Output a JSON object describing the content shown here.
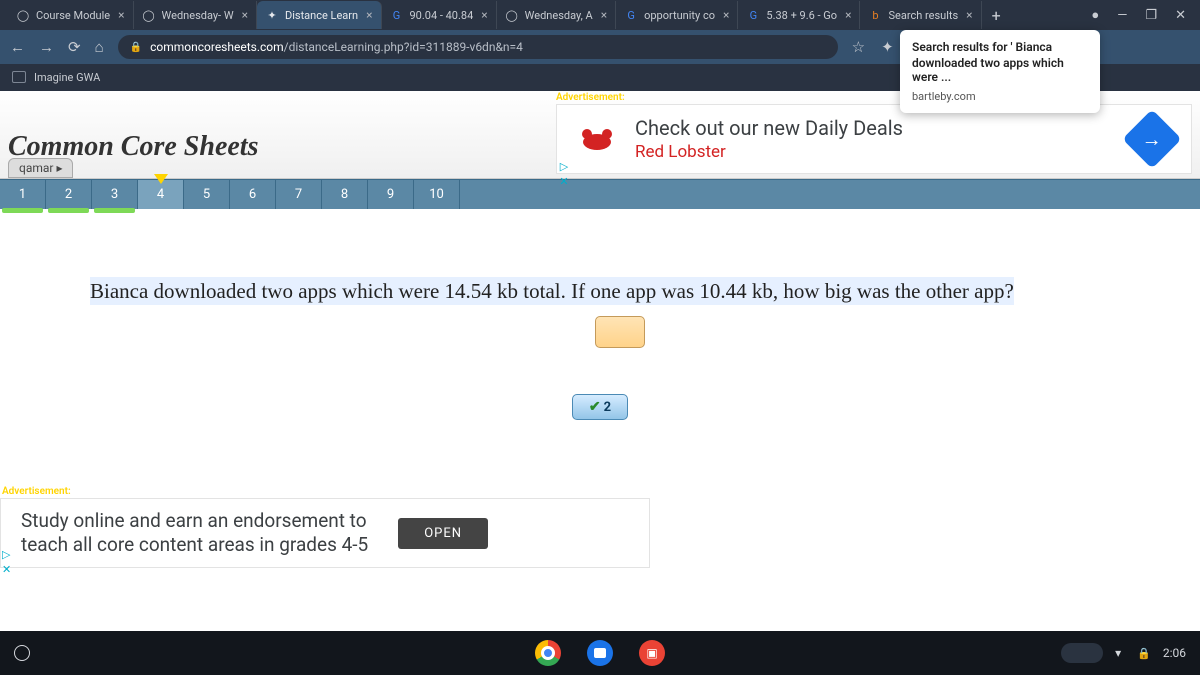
{
  "browser": {
    "tabs": [
      {
        "title": "Course Module"
      },
      {
        "title": "Wednesday- W"
      },
      {
        "title": "Distance Learn",
        "active": true
      },
      {
        "title": "90.04 - 40.84"
      },
      {
        "title": "Wednesday, A"
      },
      {
        "title": "opportunity co"
      },
      {
        "title": "5.38 + 9.6 - Go"
      },
      {
        "title": "Search results"
      }
    ],
    "url_host": "commoncoresheets.com",
    "url_path": "/distanceLearning.php?id=311889-v6dn&n=4",
    "bookmark": "Imagine GWA"
  },
  "search_popup": {
    "line1": "Search results for ' Bianca",
    "line2": "downloaded two apps which were ...",
    "site": "bartleby.com"
  },
  "site": {
    "title": "Common Core Sheets",
    "user": "qamar ▸"
  },
  "ad_top": {
    "label": "Advertisement:",
    "headline": "Check out our new Daily Deals",
    "sub": "Red Lobster"
  },
  "questions": [
    "1",
    "2",
    "3",
    "4",
    "5",
    "6",
    "7",
    "8",
    "9",
    "10"
  ],
  "current_q": 4,
  "done_q": [
    1,
    2,
    3
  ],
  "problem": "Bianca downloaded two apps which were 14.54 kb total. If one app was 10.44 kb, how big was the other app?",
  "check_label": "2",
  "ad_bottom": {
    "label": "Advertisement:",
    "text1": "Study online and earn an endorsement to",
    "text2": "teach all core content areas in grades 4-5",
    "cta": "OPEN"
  },
  "shelf": {
    "time": "2:06"
  }
}
